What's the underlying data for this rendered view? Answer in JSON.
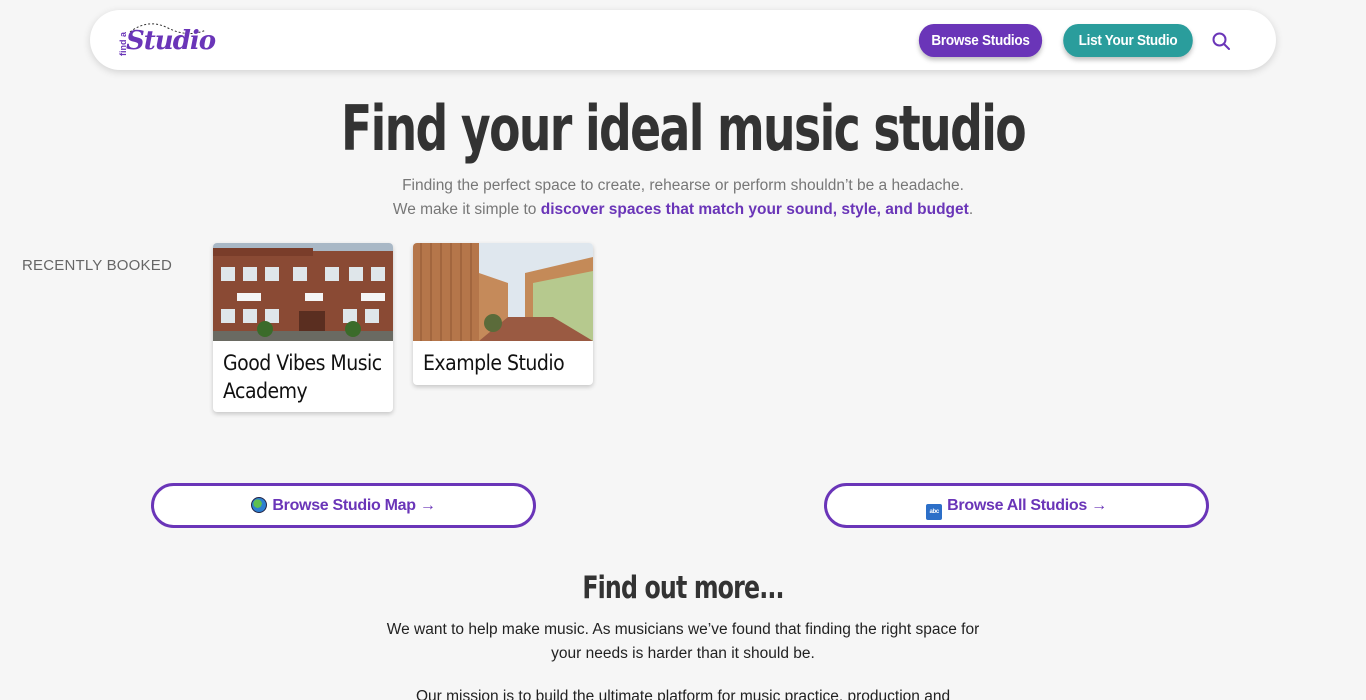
{
  "nav": {
    "logo_small": "find a",
    "logo_word": "Studio",
    "browse_label": "Browse Studios",
    "list_label": "List Your Studio",
    "search_icon": "search-icon"
  },
  "hero": {
    "title": "Find your ideal music studio",
    "sub1": "Finding the perfect space to create, rehearse or perform shouldn’t be a headache.",
    "sub2_prefix": "We make it simple to ",
    "sub2_link": "discover spaces that match your sound, style, and budget",
    "sub2_suffix": "."
  },
  "recently": {
    "label": "RECENTLY BOOKED",
    "cards": [
      {
        "title": "Good Vibes Music Academy"
      },
      {
        "title": "Example Studio"
      }
    ]
  },
  "cta": {
    "map_label": "Browse Studio Map →",
    "all_label": "Browse All Studios →",
    "map_icon": "globe-icon",
    "all_icon": "abc-icon",
    "abc_glyph": "abc"
  },
  "more": {
    "title": "Find out more...",
    "p1": "We want to help make music. As musicians we’ve found that finding the right space for your needs is harder than it should be.",
    "p2": "Our mission is to build the ultimate platform for music practice, production and"
  },
  "colors": {
    "brand_purple": "#6a35b8",
    "teal": "#2a9d9c",
    "background": "#f6f6f6"
  }
}
